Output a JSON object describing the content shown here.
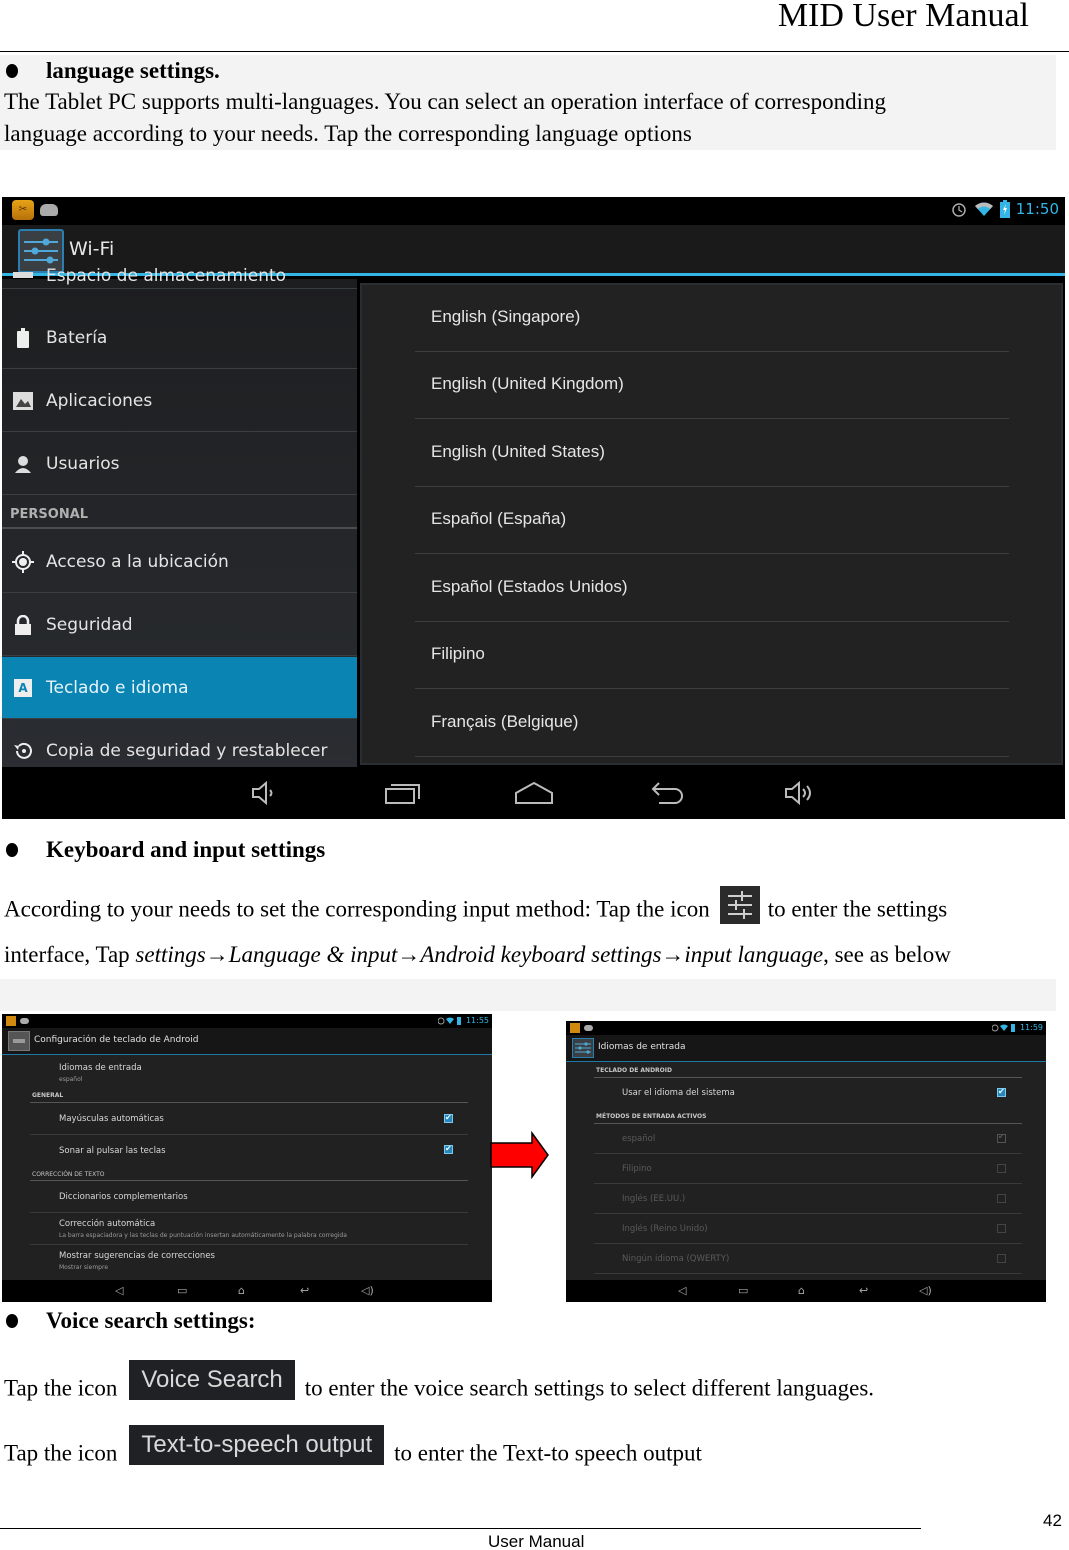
{
  "page": {
    "header_title": "MID User Manual",
    "footer_label": "User Manual",
    "page_number": "42"
  },
  "section_language": {
    "heading": "language settings.",
    "body_line1": "The Tablet PC supports multi-languages. You can select an operation interface of corresponding",
    "body_line2": "language according to your needs. Tap the corresponding language options"
  },
  "screenshot_language": {
    "status_bar": {
      "time": "11:50",
      "icons": [
        "app-icon",
        "android-icon",
        "alarm-icon",
        "wifi-icon",
        "battery-charging-icon"
      ]
    },
    "action_bar_title": "Wi-Fi",
    "accent_color": "#33b5e5",
    "selected_color": "#0a85b3",
    "settings_list": [
      {
        "label": "Espacio de almacenamiento",
        "icon": "storage-icon",
        "partial": true
      },
      {
        "label": "Batería",
        "icon": "battery-icon"
      },
      {
        "label": "Aplicaciones",
        "icon": "apps-icon"
      },
      {
        "label": "Usuarios",
        "icon": "user-icon"
      },
      {
        "category": "PERSONAL"
      },
      {
        "label": "Acceso a la ubicación",
        "icon": "location-icon"
      },
      {
        "label": "Seguridad",
        "icon": "lock-icon"
      },
      {
        "label": "Teclado e idioma",
        "icon": "keyboard-language-icon",
        "selected": true
      },
      {
        "label": "Copia de seguridad y restablecer",
        "icon": "backup-restore-icon"
      }
    ],
    "language_options": [
      "English (Singapore)",
      "English (United Kingdom)",
      "English (United States)",
      "Español (España)",
      "Español (Estados Unidos)",
      "Filipino",
      "Français (Belgique)"
    ],
    "nav_buttons": [
      "volume-down",
      "recent-apps",
      "home",
      "back",
      "volume-up"
    ]
  },
  "section_keyboard": {
    "heading": "Keyboard and input settings",
    "line1_before_icon": "According to your needs to set the corresponding input method: Tap the icon",
    "line1_after_icon": "to enter the settings",
    "line2_prefix": "interface, Tap ",
    "path": [
      "settings",
      "Language & input",
      "Android keyboard settings",
      "input language"
    ],
    "arrow": "→",
    "line2_suffix": ", see as below"
  },
  "screenshot_keyboard": {
    "time": "11:55",
    "title": "Configuración de teclado de Android",
    "items": [
      {
        "label": "Idiomas de entrada",
        "sub": "español"
      },
      {
        "category": "GENERAL"
      },
      {
        "label": "Mayúsculas automáticas",
        "checked": true
      },
      {
        "label": "Sonar al pulsar las teclas",
        "checked": true
      },
      {
        "category": "CORRECCIÓN DE TEXTO"
      },
      {
        "label": "Diccionarios complementarios"
      },
      {
        "label": "Corrección automática",
        "sub": "La barra espaciadora y las teclas de puntuación insertan automáticamente la palabra corregida"
      },
      {
        "label": "Mostrar sugerencias de correcciones",
        "sub": "Mostrar siempre"
      }
    ]
  },
  "screenshot_input_lang": {
    "time": "11:59",
    "title": "Idiomas de entrada",
    "category1": "TECLADO DE ANDROID",
    "system_lang_label": "Usar el idioma del sistema",
    "system_lang_checked": true,
    "category2": "MÉTODOS DE ENTRADA ACTIVOS",
    "methods": [
      {
        "label": "español",
        "checked": true
      },
      {
        "label": "Filipino",
        "checked": false
      },
      {
        "label": "Inglés (EE.UU.)",
        "checked": false
      },
      {
        "label": "Inglés (Reino Unido)",
        "checked": false
      },
      {
        "label": "Ningún idioma (QWERTY)",
        "checked": false
      }
    ]
  },
  "section_voice": {
    "heading": "Voice search settings:",
    "line1_before": "Tap the icon",
    "voice_chip": "Voice Search",
    "line1_after": "to enter the voice search settings to select different languages.",
    "line2_before": "Tap the icon",
    "tts_chip": "Text-to-speech output",
    "line2_after": "to enter the Text-to speech output"
  }
}
